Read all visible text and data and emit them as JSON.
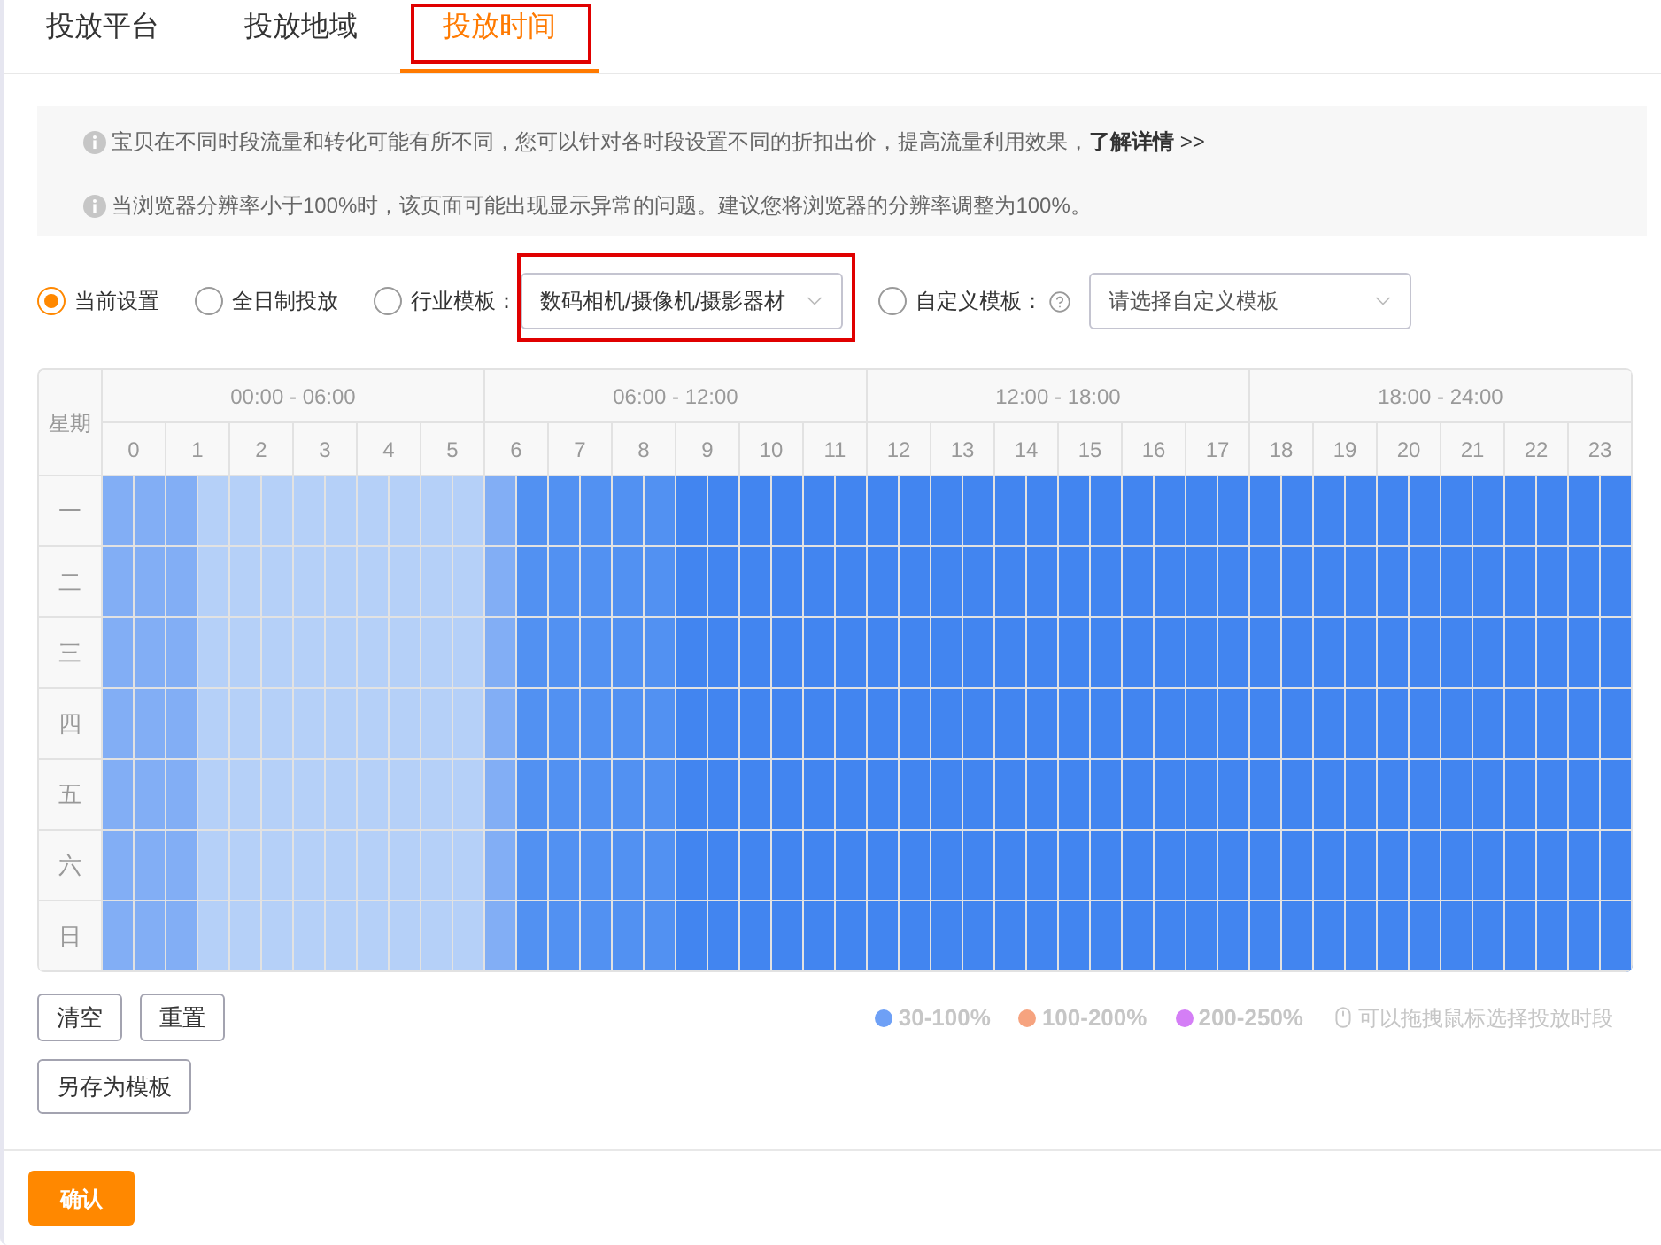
{
  "tabs": [
    {
      "label": "投放平台",
      "selected": false,
      "highlighted": false
    },
    {
      "label": "投放地域",
      "selected": false,
      "highlighted": false
    },
    {
      "label": "投放时间",
      "selected": true,
      "highlighted": true
    }
  ],
  "notices": [
    {
      "text": "宝贝在不同时段流量和转化可能有所不同，您可以针对各时段设置不同的折扣出价，提高流量利用效果，",
      "link": "**了解详情** >>"
    },
    {
      "text": "当浏览器分辨率小于100%时，该页面可能出现显示异常的问题。建议您将浏览器的分辨率调整为100%。"
    }
  ],
  "modes": [
    {
      "label": "当前设置",
      "selected": true,
      "help": false
    },
    {
      "label": "全日制投放",
      "selected": false,
      "help": false
    },
    {
      "label": "行业模板：",
      "selected": false,
      "help": false,
      "select": {
        "value": "数码相机/摄像机/摄影器材",
        "highlighted": true
      }
    },
    {
      "label": "自定义模板：",
      "selected": false,
      "help": true,
      "select": {
        "placeholder": "请选择自定义模板",
        "highlighted": false
      }
    }
  ],
  "schedule": {
    "corner": "星期",
    "groups": [
      "00:00 - 06:00",
      "06:00 - 12:00",
      "12:00 - 18:00",
      "18:00 - 24:00"
    ],
    "hours": [
      "0",
      "1",
      "2",
      "3",
      "4",
      "5",
      "6",
      "7",
      "8",
      "9",
      "10",
      "11",
      "12",
      "13",
      "14",
      "15",
      "16",
      "17",
      "18",
      "19",
      "20",
      "21",
      "22",
      "23"
    ],
    "rows": [
      {
        "day": "一",
        "cells": [
          {
            "color": "#82aef5"
          },
          {
            "color": "#82aef5"
          },
          {
            "color": "#82aef5"
          },
          {
            "color": "#b5d0f8"
          },
          {
            "color": "#b5d0f8"
          },
          {
            "color": "#b5d0f8"
          },
          {
            "color": "#b5d0f8"
          },
          {
            "color": "#b5d0f8"
          },
          {
            "color": "#b5d0f8"
          },
          {
            "color": "#b5d0f8"
          },
          {
            "color": "#b5d0f8"
          },
          {
            "color": "#b5d0f8"
          },
          {
            "color": "#82aef5"
          },
          {
            "color": "#5291f2"
          },
          {
            "color": "#5291f2"
          },
          {
            "color": "#5291f2"
          },
          {
            "color": "#5291f2"
          },
          {
            "color": "#5291f2"
          },
          {
            "color": "#4285f0"
          },
          {
            "color": "#4285f0"
          },
          {
            "color": "#4285f0"
          },
          {
            "color": "#4285f0"
          },
          {
            "color": "#4285f0"
          },
          {
            "color": "#4285f0"
          },
          {
            "color": "#4285f0"
          },
          {
            "color": "#4285f0"
          },
          {
            "color": "#4285f0"
          },
          {
            "color": "#4285f0"
          },
          {
            "color": "#4285f0"
          },
          {
            "color": "#4285f0"
          },
          {
            "color": "#4285f0"
          },
          {
            "color": "#4285f0"
          },
          {
            "color": "#4285f0"
          },
          {
            "color": "#4285f0"
          },
          {
            "color": "#4285f0"
          },
          {
            "color": "#4285f0"
          },
          {
            "color": "#4285f0"
          },
          {
            "color": "#4285f0"
          },
          {
            "color": "#4285f0"
          },
          {
            "color": "#4285f0"
          },
          {
            "color": "#4285f0"
          },
          {
            "color": "#4285f0"
          },
          {
            "color": "#4285f0"
          },
          {
            "color": "#4285f0"
          },
          {
            "color": "#4285f0"
          },
          {
            "color": "#4285f0"
          },
          {
            "color": "#4285f0"
          },
          {
            "color": "#4285f0"
          }
        ]
      },
      {
        "day": "二",
        "cells": [
          {
            "color": "#82aef5"
          },
          {
            "color": "#82aef5"
          },
          {
            "color": "#82aef5"
          },
          {
            "color": "#b5d0f8"
          },
          {
            "color": "#b5d0f8"
          },
          {
            "color": "#b5d0f8"
          },
          {
            "color": "#b5d0f8"
          },
          {
            "color": "#b5d0f8"
          },
          {
            "color": "#b5d0f8"
          },
          {
            "color": "#b5d0f8"
          },
          {
            "color": "#b5d0f8"
          },
          {
            "color": "#b5d0f8"
          },
          {
            "color": "#82aef5"
          },
          {
            "color": "#5291f2"
          },
          {
            "color": "#5291f2"
          },
          {
            "color": "#5291f2"
          },
          {
            "color": "#5291f2"
          },
          {
            "color": "#5291f2"
          },
          {
            "color": "#4285f0"
          },
          {
            "color": "#4285f0"
          },
          {
            "color": "#4285f0"
          },
          {
            "color": "#4285f0"
          },
          {
            "color": "#4285f0"
          },
          {
            "color": "#4285f0"
          },
          {
            "color": "#4285f0"
          },
          {
            "color": "#4285f0"
          },
          {
            "color": "#4285f0"
          },
          {
            "color": "#4285f0"
          },
          {
            "color": "#4285f0"
          },
          {
            "color": "#4285f0"
          },
          {
            "color": "#4285f0"
          },
          {
            "color": "#4285f0"
          },
          {
            "color": "#4285f0"
          },
          {
            "color": "#4285f0"
          },
          {
            "color": "#4285f0"
          },
          {
            "color": "#4285f0"
          },
          {
            "color": "#4285f0"
          },
          {
            "color": "#4285f0"
          },
          {
            "color": "#4285f0"
          },
          {
            "color": "#4285f0"
          },
          {
            "color": "#4285f0"
          },
          {
            "color": "#4285f0"
          },
          {
            "color": "#4285f0"
          },
          {
            "color": "#4285f0"
          },
          {
            "color": "#4285f0"
          },
          {
            "color": "#4285f0"
          },
          {
            "color": "#4285f0"
          },
          {
            "color": "#4285f0"
          }
        ]
      },
      {
        "day": "三",
        "cells": [
          {
            "color": "#82aef5"
          },
          {
            "color": "#82aef5"
          },
          {
            "color": "#82aef5"
          },
          {
            "color": "#b5d0f8"
          },
          {
            "color": "#b5d0f8"
          },
          {
            "color": "#b5d0f8"
          },
          {
            "color": "#b5d0f8"
          },
          {
            "color": "#b5d0f8"
          },
          {
            "color": "#b5d0f8"
          },
          {
            "color": "#b5d0f8"
          },
          {
            "color": "#b5d0f8"
          },
          {
            "color": "#b5d0f8"
          },
          {
            "color": "#82aef5"
          },
          {
            "color": "#5291f2"
          },
          {
            "color": "#5291f2"
          },
          {
            "color": "#5291f2"
          },
          {
            "color": "#5291f2"
          },
          {
            "color": "#5291f2"
          },
          {
            "color": "#4285f0"
          },
          {
            "color": "#4285f0"
          },
          {
            "color": "#4285f0"
          },
          {
            "color": "#4285f0"
          },
          {
            "color": "#4285f0"
          },
          {
            "color": "#4285f0"
          },
          {
            "color": "#4285f0"
          },
          {
            "color": "#4285f0"
          },
          {
            "color": "#4285f0"
          },
          {
            "color": "#4285f0"
          },
          {
            "color": "#4285f0"
          },
          {
            "color": "#4285f0"
          },
          {
            "color": "#4285f0"
          },
          {
            "color": "#4285f0"
          },
          {
            "color": "#4285f0"
          },
          {
            "color": "#4285f0"
          },
          {
            "color": "#4285f0"
          },
          {
            "color": "#4285f0"
          },
          {
            "color": "#4285f0"
          },
          {
            "color": "#4285f0"
          },
          {
            "color": "#4285f0"
          },
          {
            "color": "#4285f0"
          },
          {
            "color": "#4285f0"
          },
          {
            "color": "#4285f0"
          },
          {
            "color": "#4285f0"
          },
          {
            "color": "#4285f0"
          },
          {
            "color": "#4285f0"
          },
          {
            "color": "#4285f0"
          },
          {
            "color": "#4285f0"
          },
          {
            "color": "#4285f0"
          }
        ]
      },
      {
        "day": "四",
        "cells": [
          {
            "color": "#82aef5"
          },
          {
            "color": "#82aef5"
          },
          {
            "color": "#82aef5"
          },
          {
            "color": "#b5d0f8"
          },
          {
            "color": "#b5d0f8"
          },
          {
            "color": "#b5d0f8"
          },
          {
            "color": "#b5d0f8"
          },
          {
            "color": "#b5d0f8"
          },
          {
            "color": "#b5d0f8"
          },
          {
            "color": "#b5d0f8"
          },
          {
            "color": "#b5d0f8"
          },
          {
            "color": "#b5d0f8"
          },
          {
            "color": "#82aef5"
          },
          {
            "color": "#5291f2"
          },
          {
            "color": "#5291f2"
          },
          {
            "color": "#5291f2"
          },
          {
            "color": "#5291f2"
          },
          {
            "color": "#5291f2"
          },
          {
            "color": "#4285f0"
          },
          {
            "color": "#4285f0"
          },
          {
            "color": "#4285f0"
          },
          {
            "color": "#4285f0"
          },
          {
            "color": "#4285f0"
          },
          {
            "color": "#4285f0"
          },
          {
            "color": "#4285f0"
          },
          {
            "color": "#4285f0"
          },
          {
            "color": "#4285f0"
          },
          {
            "color": "#4285f0"
          },
          {
            "color": "#4285f0"
          },
          {
            "color": "#4285f0"
          },
          {
            "color": "#4285f0"
          },
          {
            "color": "#4285f0"
          },
          {
            "color": "#4285f0"
          },
          {
            "color": "#4285f0"
          },
          {
            "color": "#4285f0"
          },
          {
            "color": "#4285f0"
          },
          {
            "color": "#4285f0"
          },
          {
            "color": "#4285f0"
          },
          {
            "color": "#4285f0"
          },
          {
            "color": "#4285f0"
          },
          {
            "color": "#4285f0"
          },
          {
            "color": "#4285f0"
          },
          {
            "color": "#4285f0"
          },
          {
            "color": "#4285f0"
          },
          {
            "color": "#4285f0"
          },
          {
            "color": "#4285f0"
          },
          {
            "color": "#4285f0"
          },
          {
            "color": "#4285f0"
          }
        ]
      },
      {
        "day": "五",
        "cells": [
          {
            "color": "#82aef5"
          },
          {
            "color": "#82aef5"
          },
          {
            "color": "#82aef5"
          },
          {
            "color": "#b5d0f8"
          },
          {
            "color": "#b5d0f8"
          },
          {
            "color": "#b5d0f8"
          },
          {
            "color": "#b5d0f8"
          },
          {
            "color": "#b5d0f8"
          },
          {
            "color": "#b5d0f8"
          },
          {
            "color": "#b5d0f8"
          },
          {
            "color": "#b5d0f8"
          },
          {
            "color": "#b5d0f8"
          },
          {
            "color": "#82aef5"
          },
          {
            "color": "#5291f2"
          },
          {
            "color": "#5291f2"
          },
          {
            "color": "#5291f2"
          },
          {
            "color": "#5291f2"
          },
          {
            "color": "#5291f2"
          },
          {
            "color": "#4285f0"
          },
          {
            "color": "#4285f0"
          },
          {
            "color": "#4285f0"
          },
          {
            "color": "#4285f0"
          },
          {
            "color": "#4285f0"
          },
          {
            "color": "#4285f0"
          },
          {
            "color": "#4285f0"
          },
          {
            "color": "#4285f0"
          },
          {
            "color": "#4285f0"
          },
          {
            "color": "#4285f0"
          },
          {
            "color": "#4285f0"
          },
          {
            "color": "#4285f0"
          },
          {
            "color": "#4285f0"
          },
          {
            "color": "#4285f0"
          },
          {
            "color": "#4285f0"
          },
          {
            "color": "#4285f0"
          },
          {
            "color": "#4285f0"
          },
          {
            "color": "#4285f0"
          },
          {
            "color": "#4285f0"
          },
          {
            "color": "#4285f0"
          },
          {
            "color": "#4285f0"
          },
          {
            "color": "#4285f0"
          },
          {
            "color": "#4285f0"
          },
          {
            "color": "#4285f0"
          },
          {
            "color": "#4285f0"
          },
          {
            "color": "#4285f0"
          },
          {
            "color": "#4285f0"
          },
          {
            "color": "#4285f0"
          },
          {
            "color": "#4285f0"
          },
          {
            "color": "#4285f0"
          }
        ]
      },
      {
        "day": "六",
        "cells": [
          {
            "color": "#82aef5"
          },
          {
            "color": "#82aef5"
          },
          {
            "color": "#82aef5"
          },
          {
            "color": "#b5d0f8"
          },
          {
            "color": "#b5d0f8"
          },
          {
            "color": "#b5d0f8"
          },
          {
            "color": "#b5d0f8"
          },
          {
            "color": "#b5d0f8"
          },
          {
            "color": "#b5d0f8"
          },
          {
            "color": "#b5d0f8"
          },
          {
            "color": "#b5d0f8"
          },
          {
            "color": "#b5d0f8"
          },
          {
            "color": "#82aef5"
          },
          {
            "color": "#5291f2"
          },
          {
            "color": "#5291f2"
          },
          {
            "color": "#5291f2"
          },
          {
            "color": "#5291f2"
          },
          {
            "color": "#5291f2"
          },
          {
            "color": "#4285f0"
          },
          {
            "color": "#4285f0"
          },
          {
            "color": "#4285f0"
          },
          {
            "color": "#4285f0"
          },
          {
            "color": "#4285f0"
          },
          {
            "color": "#4285f0"
          },
          {
            "color": "#4285f0"
          },
          {
            "color": "#4285f0"
          },
          {
            "color": "#4285f0"
          },
          {
            "color": "#4285f0"
          },
          {
            "color": "#4285f0"
          },
          {
            "color": "#4285f0"
          },
          {
            "color": "#4285f0"
          },
          {
            "color": "#4285f0"
          },
          {
            "color": "#4285f0"
          },
          {
            "color": "#4285f0"
          },
          {
            "color": "#4285f0"
          },
          {
            "color": "#4285f0"
          },
          {
            "color": "#4285f0"
          },
          {
            "color": "#4285f0"
          },
          {
            "color": "#4285f0"
          },
          {
            "color": "#4285f0"
          },
          {
            "color": "#4285f0"
          },
          {
            "color": "#4285f0"
          },
          {
            "color": "#4285f0"
          },
          {
            "color": "#4285f0"
          },
          {
            "color": "#4285f0"
          },
          {
            "color": "#4285f0"
          },
          {
            "color": "#4285f0"
          },
          {
            "color": "#4285f0"
          }
        ]
      },
      {
        "day": "日",
        "cells": [
          {
            "color": "#82aef5"
          },
          {
            "color": "#82aef5"
          },
          {
            "color": "#82aef5"
          },
          {
            "color": "#b5d0f8"
          },
          {
            "color": "#b5d0f8"
          },
          {
            "color": "#b5d0f8"
          },
          {
            "color": "#b5d0f8"
          },
          {
            "color": "#b5d0f8"
          },
          {
            "color": "#b5d0f8"
          },
          {
            "color": "#b5d0f8"
          },
          {
            "color": "#b5d0f8"
          },
          {
            "color": "#b5d0f8"
          },
          {
            "color": "#82aef5"
          },
          {
            "color": "#5291f2"
          },
          {
            "color": "#5291f2"
          },
          {
            "color": "#5291f2"
          },
          {
            "color": "#5291f2"
          },
          {
            "color": "#5291f2"
          },
          {
            "color": "#4285f0"
          },
          {
            "color": "#4285f0"
          },
          {
            "color": "#4285f0"
          },
          {
            "color": "#4285f0"
          },
          {
            "color": "#4285f0"
          },
          {
            "color": "#4285f0"
          },
          {
            "color": "#4285f0"
          },
          {
            "color": "#4285f0"
          },
          {
            "color": "#4285f0"
          },
          {
            "color": "#4285f0"
          },
          {
            "color": "#4285f0"
          },
          {
            "color": "#4285f0"
          },
          {
            "color": "#4285f0"
          },
          {
            "color": "#4285f0"
          },
          {
            "color": "#4285f0"
          },
          {
            "color": "#4285f0"
          },
          {
            "color": "#4285f0"
          },
          {
            "color": "#4285f0"
          },
          {
            "color": "#4285f0"
          },
          {
            "color": "#4285f0"
          },
          {
            "color": "#4285f0"
          },
          {
            "color": "#4285f0"
          },
          {
            "color": "#4285f0"
          },
          {
            "color": "#4285f0"
          },
          {
            "color": "#4285f0"
          },
          {
            "color": "#4285f0"
          },
          {
            "color": "#4285f0"
          },
          {
            "color": "#4285f0"
          },
          {
            "color": "#4285f0"
          },
          {
            "color": "#4285f0"
          }
        ]
      }
    ]
  },
  "action_rows": [
    [
      "清空",
      "重置"
    ],
    [
      "另存为模板"
    ]
  ],
  "legend": [
    {
      "label": "30-100%",
      "color": "#6ea0f6"
    },
    {
      "label": "100-200%",
      "color": "#f6a37f"
    },
    {
      "label": "200-250%",
      "color": "#d47ef6"
    }
  ],
  "hint": "可以拖拽鼠标选择投放时段",
  "confirm": "确认"
}
